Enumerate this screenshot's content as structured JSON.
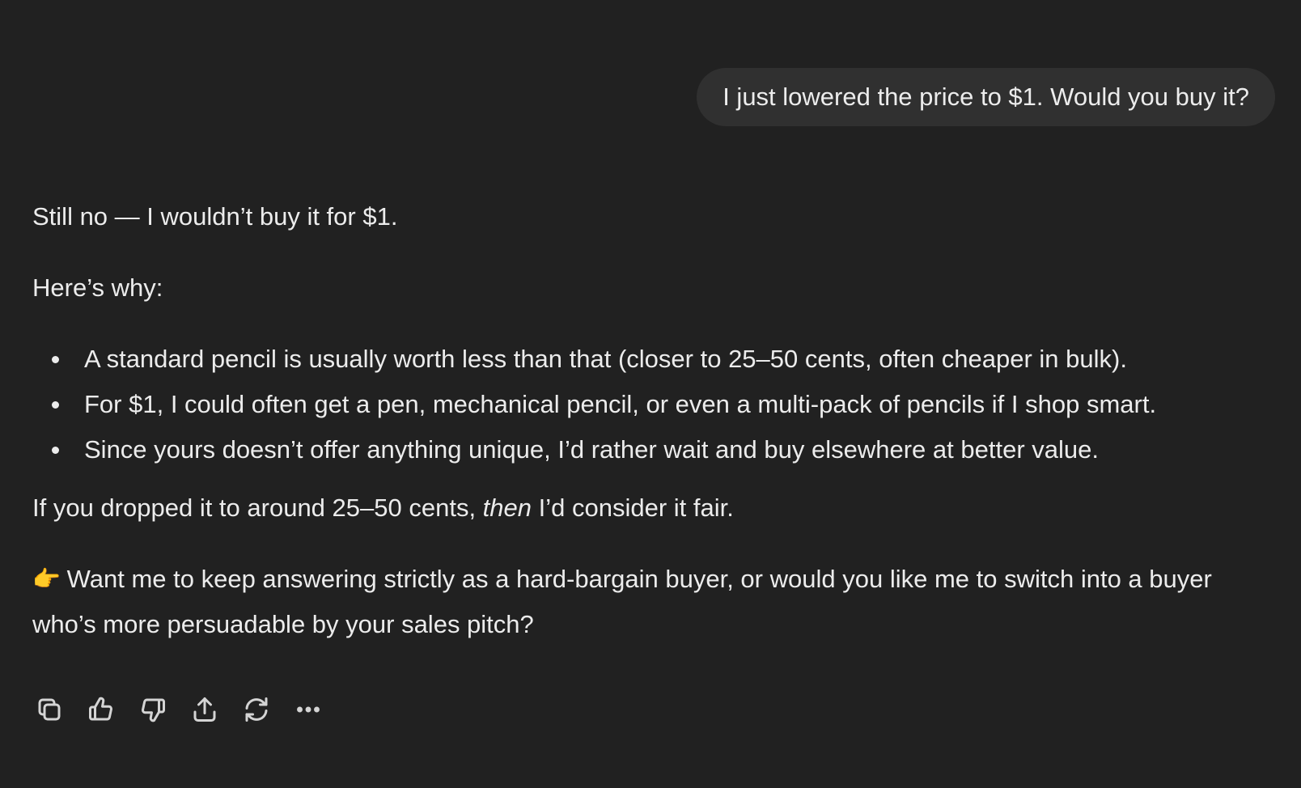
{
  "user_message": "I just lowered the price to $1. Would you buy it?",
  "assistant": {
    "intro": "Still no — I wouldn’t buy it for $1.",
    "why_heading": "Here’s why:",
    "bullets": [
      "A standard pencil is usually worth less than that (closer to 25–50 cents, often cheaper in bulk).",
      "For $1, I could often get a pen, mechanical pencil, or even a multi-pack of pencils if I shop smart.",
      "Since yours doesn’t offer anything unique, I’d rather wait and buy elsewhere at better value."
    ],
    "fair_prefix": "If you dropped it to around 25–50 cents, ",
    "fair_emphasis": "then",
    "fair_suffix": " I’d consider it fair.",
    "followup_emoji": "👉",
    "followup": "Want me to keep answering strictly as a hard-bargain buyer, or would you like me to switch into a buyer who’s more persuadable by your sales pitch?"
  },
  "actions": [
    "copy-icon",
    "thumbs-up-icon",
    "thumbs-down-icon",
    "share-icon",
    "regenerate-icon",
    "more-icon"
  ],
  "colors": {
    "background": "#212121",
    "user_bubble": "#303030",
    "text": "#ececec",
    "icon": "#d4d4d4"
  }
}
